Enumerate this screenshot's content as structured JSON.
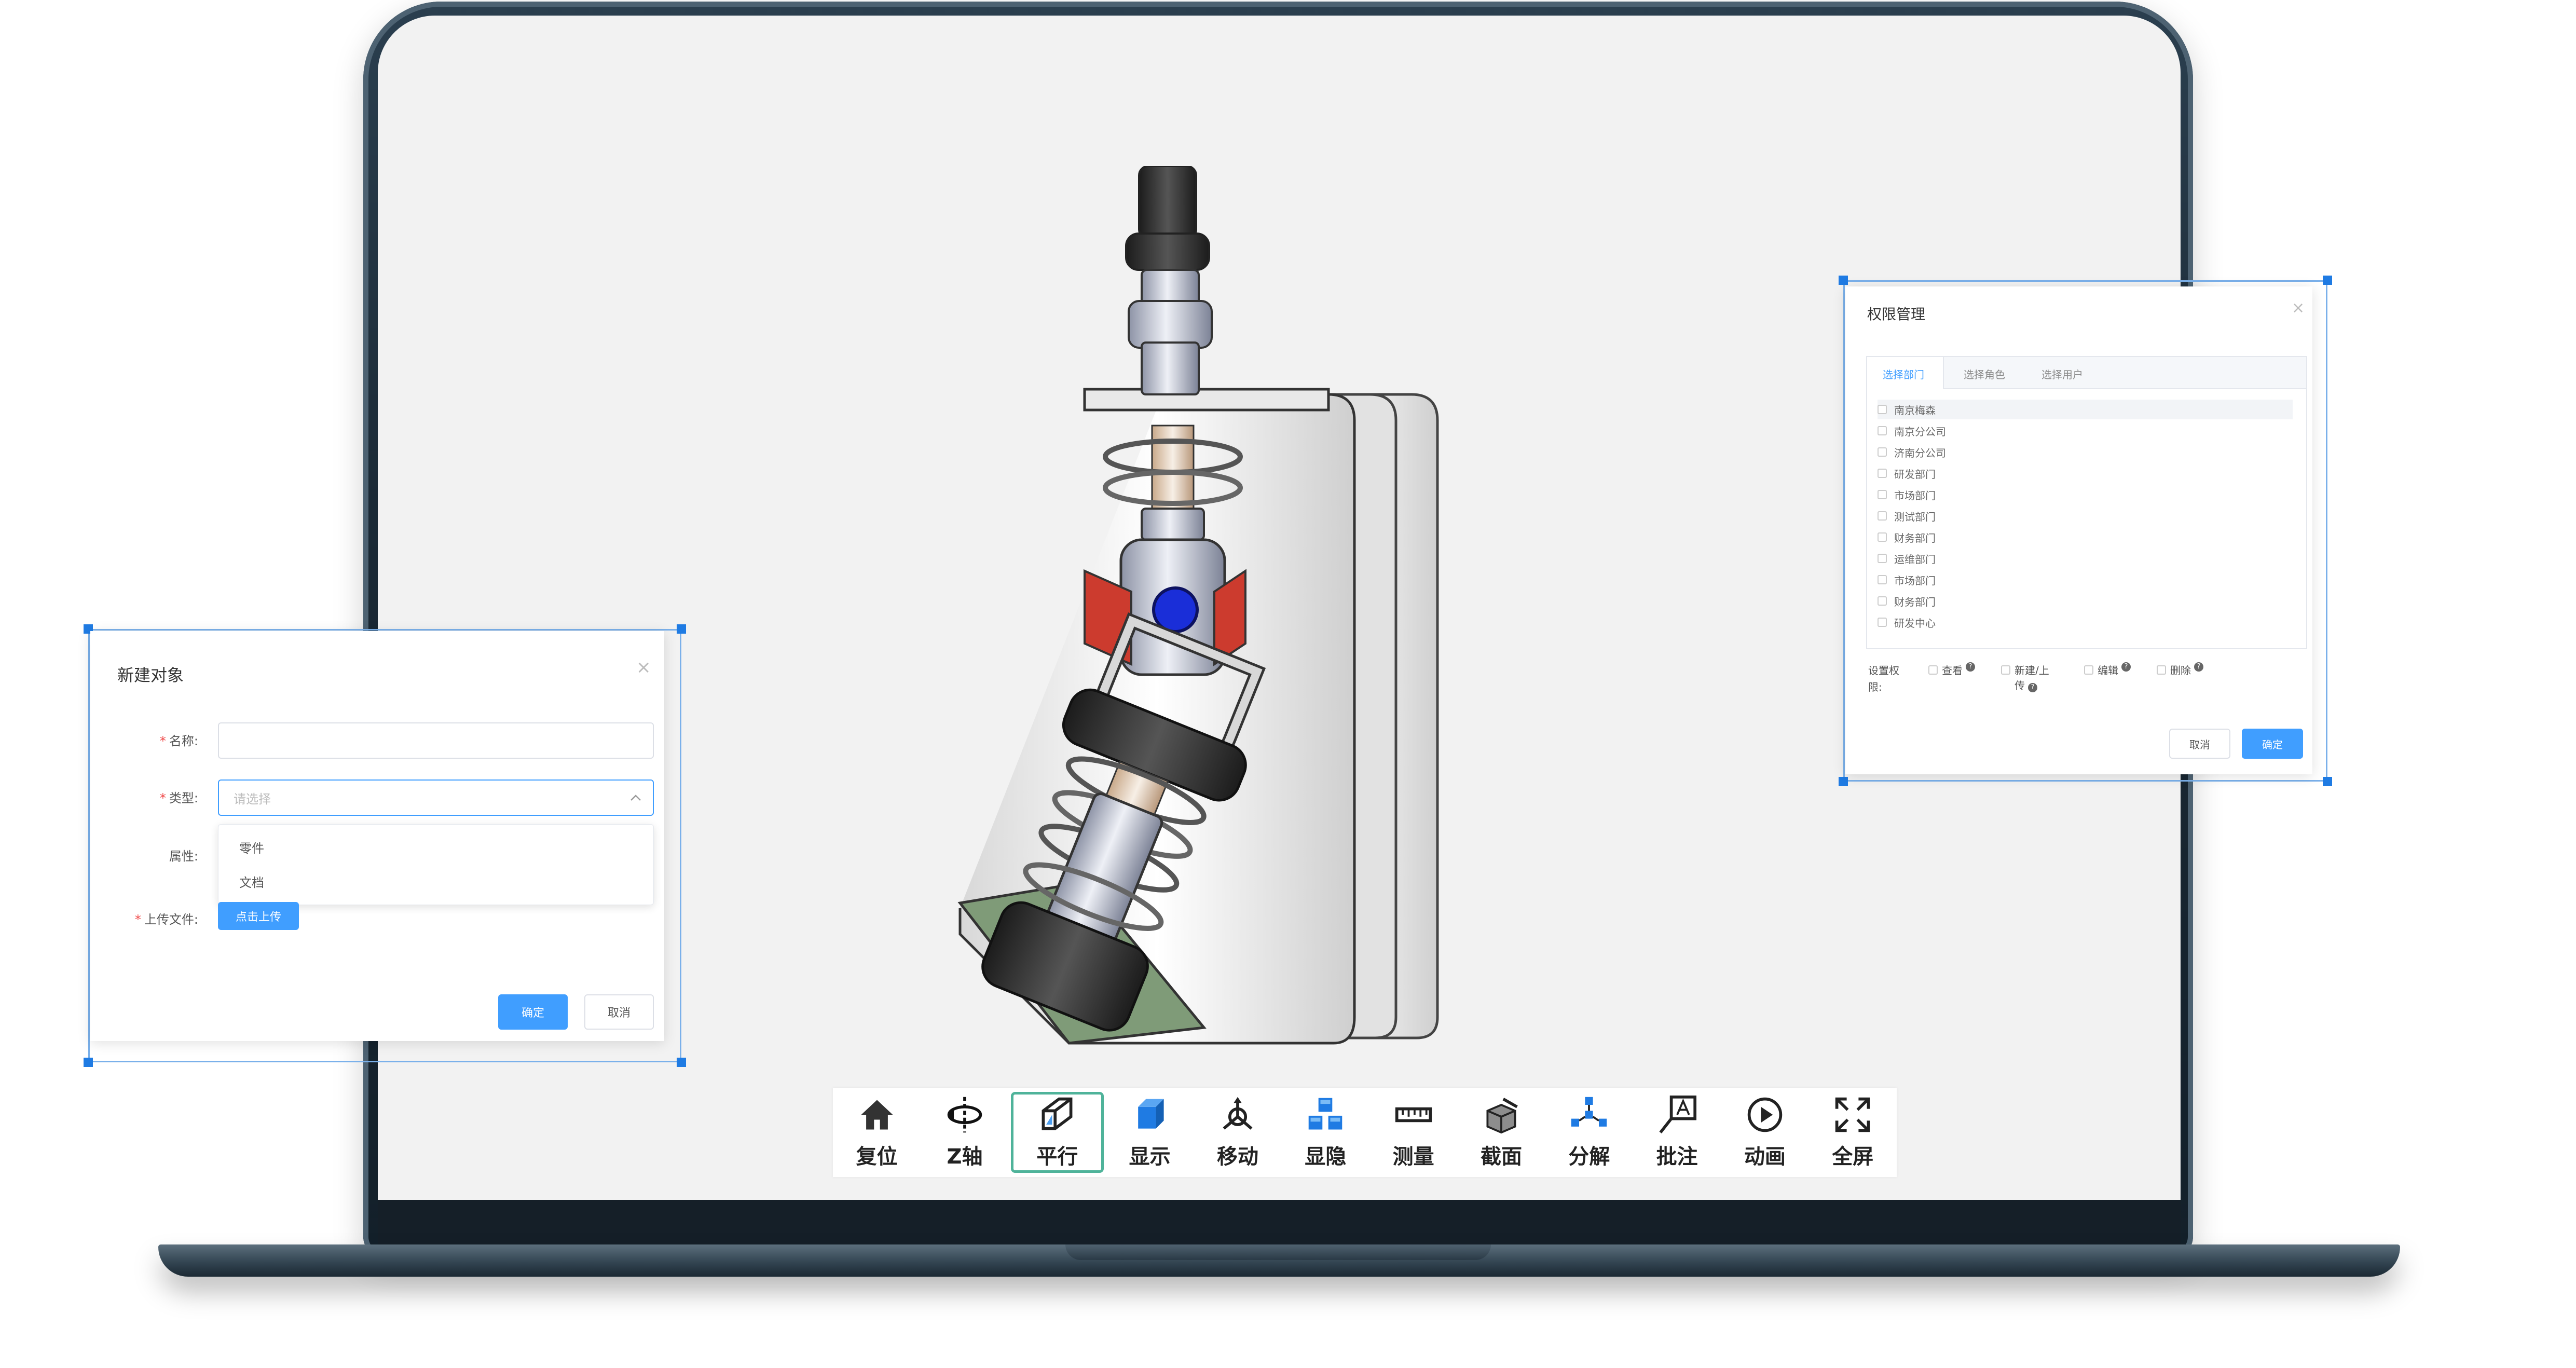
{
  "toolbar": {
    "items": [
      {
        "label": "复位",
        "icon": "home-icon"
      },
      {
        "label": "Z轴",
        "icon": "z-axis-rotate-icon"
      },
      {
        "label": "平行",
        "icon": "parallel-projection-icon",
        "active": true
      },
      {
        "label": "显示",
        "icon": "cube-display-icon"
      },
      {
        "label": "移动",
        "icon": "move-axes-icon"
      },
      {
        "label": "显隐",
        "icon": "show-hide-cubes-icon"
      },
      {
        "label": "测量",
        "icon": "ruler-icon"
      },
      {
        "label": "截面",
        "icon": "section-cut-icon"
      },
      {
        "label": "分解",
        "icon": "explode-icon"
      },
      {
        "label": "批注",
        "icon": "annotation-icon"
      },
      {
        "label": "动画",
        "icon": "play-animation-icon"
      },
      {
        "label": "全屏",
        "icon": "fullscreen-icon"
      }
    ]
  },
  "new_object_dialog": {
    "title": "新建对象",
    "close": "×",
    "name_label": "名称:",
    "type_label": "类型:",
    "type_placeholder": "请选择",
    "attr_label": "属性:",
    "upload_label": "上传文件:",
    "upload_button": "点击上传",
    "type_options": [
      "零件",
      "文档"
    ],
    "confirm": "确定",
    "cancel": "取消"
  },
  "permission_dialog": {
    "title": "权限管理",
    "close": "×",
    "tabs": [
      "选择部门",
      "选择角色",
      "选择用户"
    ],
    "departments": [
      "南京梅森",
      "南京分公司",
      "济南分公司",
      "研发部门",
      "市场部门",
      "测试部门",
      "财务部门",
      "运维部门",
      "市场部门",
      "财务部门",
      "研发中心"
    ],
    "set_perm_label_1": "设置权",
    "set_perm_label_2": "限:",
    "perms": [
      {
        "label": "查看"
      },
      {
        "label": "新建/上",
        "label2": "传"
      },
      {
        "label": "编辑"
      },
      {
        "label": "删除"
      }
    ],
    "cancel": "取消",
    "confirm": "确定"
  },
  "colors": {
    "accent": "#409eff",
    "active_tool_border": "#4fb39a",
    "handle": "#1f7be3",
    "bezel": "#1b2a36"
  }
}
